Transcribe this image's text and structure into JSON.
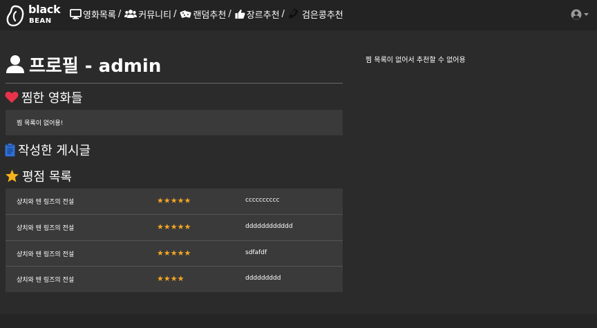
{
  "brand": {
    "name": "black",
    "sub": "BEAN"
  },
  "nav": {
    "items": [
      {
        "label": "영화목록",
        "icon": "monitor-icon"
      },
      {
        "label": "커뮤니티",
        "icon": "users-icon"
      },
      {
        "label": "랜덤추천",
        "icon": "dice-icon"
      },
      {
        "label": "장르추천",
        "icon": "thumbs-up-icon"
      },
      {
        "label": "검은콩추천",
        "icon": "bean-icon"
      }
    ],
    "separator": "/"
  },
  "profile": {
    "title": "프로필 - admin",
    "liked_heading": "찜한 영화들",
    "liked_empty": "찜 목록이 없어용!",
    "posts_heading": "작성한 게시글",
    "ratings_heading": "평점 목록",
    "ratings": [
      {
        "movie": "샹치와 텐 링즈의 전설",
        "stars": "★★★★★",
        "review": "cccccccccc"
      },
      {
        "movie": "샹치와 텐 링즈의 전설",
        "stars": "★★★★★",
        "review": "dddddddddddd"
      },
      {
        "movie": "샹치와 텐 링즈의 전설",
        "stars": "★★★★★",
        "review": "sdfafdf"
      },
      {
        "movie": "샹치와 텐 링즈의 전설",
        "stars": "★★★★",
        "review": "ddddddddd"
      }
    ]
  },
  "recommendation": {
    "message": "찜 목록이 없어서 추천할 수 없어용"
  },
  "colors": {
    "background": "#2b2b2b",
    "navbar": "#232323",
    "panel": "#3a3a3a",
    "star": "#f5a623",
    "heart": "#e8334a",
    "clipboard": "#2f6fd6"
  }
}
